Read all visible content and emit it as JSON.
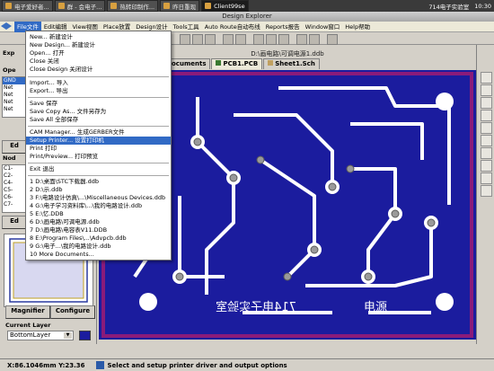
{
  "taskbar": {
    "items": [
      {
        "label": "电子爱好者..."
      },
      {
        "label": "群 - 会电子..."
      },
      {
        "label": "热转印制作..."
      },
      {
        "label": "昨日重现"
      },
      {
        "label": "Client99se",
        "active": true
      }
    ],
    "tray_text": "714电子实验室",
    "clock": "10:30"
  },
  "window": {
    "title": "Design Explorer"
  },
  "menu": {
    "items": [
      {
        "label": "File文件",
        "active": true
      },
      {
        "label": "Edit编辑"
      },
      {
        "label": "View视图"
      },
      {
        "label": "Place放置"
      },
      {
        "label": "Design设计"
      },
      {
        "label": "Tools工具"
      },
      {
        "label": "Auto Route自动布线"
      },
      {
        "label": "Reports报告"
      },
      {
        "label": "Window窗口"
      },
      {
        "label": "Help帮助"
      }
    ]
  },
  "file_menu": {
    "groups": [
      [
        "New... 新建设计",
        "New Design... 新建设计",
        "Open... 打开",
        "Close 关闭",
        "Close Design 关闭设计"
      ],
      [
        "Import... 导入",
        "Export... 导出"
      ],
      [
        "Save 保存",
        "Save Copy As... 文件另存为",
        "Save All 全部保存"
      ],
      [
        "CAM Manager... 生成GERBER文件",
        "Setup Printer... 设置打印机",
        "Print 打印",
        "Print/Preview... 打印预览"
      ],
      [
        "Exit 退出"
      ],
      [
        "1 D:\\桌面\\STC下载器.ddb",
        "2 D:\\示.ddb",
        "3 F:\\电路设计仿真\\...\\Miscellaneous Devices.ddb",
        "4 G:\\电子学习资料库\\...\\我的电路设计.ddb",
        "5 E:\\忆.DDB",
        "6 D:\\画电路\\可调电源.ddb",
        "7 D:\\画电路\\电容表V11.DDB",
        "8 E:\\Program Files\\...\\Advpcb.ddb",
        "9 G:\\电子...\\我的电路设计.ddb",
        "10 More Documents..."
      ]
    ],
    "highlighted": "Setup Printer... 设置打印机"
  },
  "left_panel": {
    "browse_label": "Exp",
    "open_label": "Ope",
    "nets": [
      "GND",
      "Net",
      "Net",
      "Net",
      "Net"
    ],
    "edit_label": "Ed",
    "node_label": "Nod",
    "nodes": [
      "C1-",
      "C2-",
      "C4-",
      "C5-",
      "C6-",
      "C7-"
    ],
    "edit2_label": "Ed",
    "magnifier_label": "Magnifier",
    "configure_label": "Configure",
    "current_layer_label": "Current Layer",
    "current_layer_value": "BottomLayer",
    "layer_color": "#1b1c9e"
  },
  "document": {
    "path": "D:\\画电路\\可调电源1.ddb",
    "tabs": [
      {
        "label": "ocuments"
      },
      {
        "label": "PCB1.PCB",
        "active": true
      },
      {
        "label": "Sheet1.Sch"
      }
    ]
  },
  "pcb": {
    "board_color": "#1b1c9e",
    "outline_color": "#8a1b7a",
    "trace_color": "#ffffff",
    "pad_color": "#9a9a9a",
    "silk_text_left": "714电子实验室",
    "silk_text_right": "电源"
  },
  "status": {
    "coords": "X:86.1046mm Y:23.36",
    "message": "Select and setup printer driver and output options"
  }
}
